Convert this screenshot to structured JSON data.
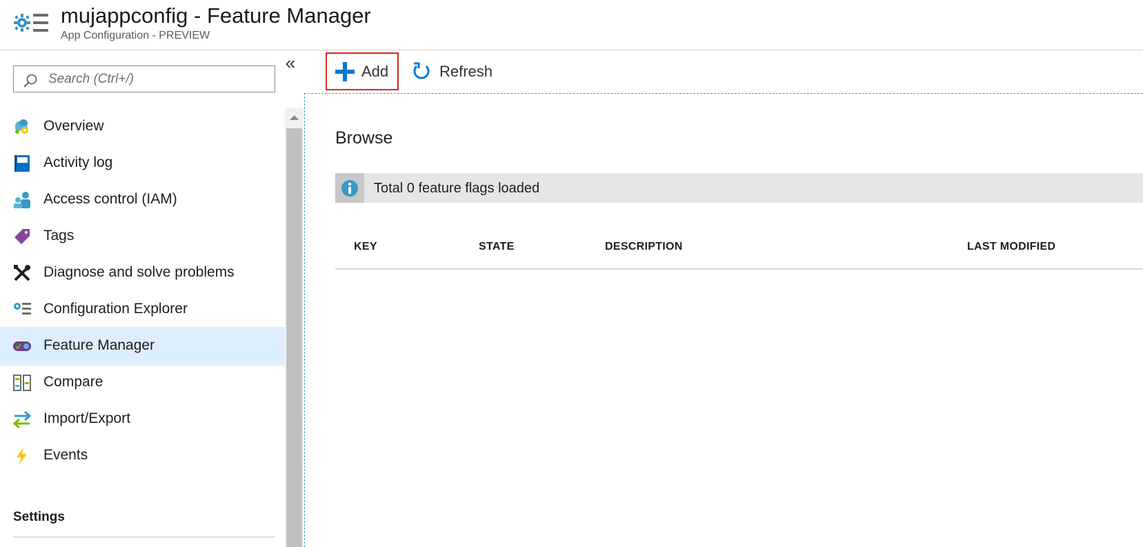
{
  "header": {
    "title": "mujappconfig - Feature Manager",
    "subtitle": "App Configuration - PREVIEW",
    "icon": "app-config-gear-list-icon"
  },
  "sidebar": {
    "search_placeholder": "Search (Ctrl+/)",
    "collapse_label": "«",
    "items": [
      {
        "label": "Overview",
        "icon": "cloud-gear-icon",
        "selected": false
      },
      {
        "label": "Activity log",
        "icon": "book-icon",
        "selected": false
      },
      {
        "label": "Access control (IAM)",
        "icon": "people-icon",
        "selected": false
      },
      {
        "label": "Tags",
        "icon": "tag-icon",
        "selected": false
      },
      {
        "label": "Diagnose and solve problems",
        "icon": "wrench-icon",
        "selected": false
      },
      {
        "label": "Configuration Explorer",
        "icon": "gear-list-icon",
        "selected": false
      },
      {
        "label": "Feature Manager",
        "icon": "toggle-icon",
        "selected": true
      },
      {
        "label": "Compare",
        "icon": "compare-icon",
        "selected": false
      },
      {
        "label": "Import/Export",
        "icon": "arrows-icon",
        "selected": false
      },
      {
        "label": "Events",
        "icon": "lightning-icon",
        "selected": false
      }
    ],
    "section": "Settings"
  },
  "toolbar": {
    "add_label": "Add",
    "refresh_label": "Refresh"
  },
  "main": {
    "title": "Browse",
    "info": "Total 0 feature flags loaded",
    "columns": [
      "KEY",
      "STATE",
      "DESCRIPTION",
      "LAST MODIFIED"
    ]
  },
  "colors": {
    "accent": "#0078d4",
    "selected_bg": "#ddeeff",
    "highlight_border": "#d52b1e"
  }
}
